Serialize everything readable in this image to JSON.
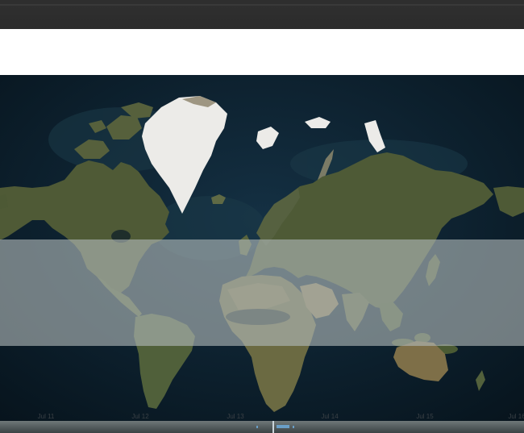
{
  "map": {
    "base_layer": "satellite imagery",
    "projection": "web-mercator",
    "colors": {
      "ocean": "#0d2433",
      "land": "#4e5a36",
      "ice": "#ecebe8"
    }
  },
  "timeline": {
    "ticks": [
      "Jul 11",
      "Jul 12",
      "Jul 13",
      "Jul 14",
      "Jul 15",
      "Jul 16"
    ],
    "color": "#3a4146"
  }
}
